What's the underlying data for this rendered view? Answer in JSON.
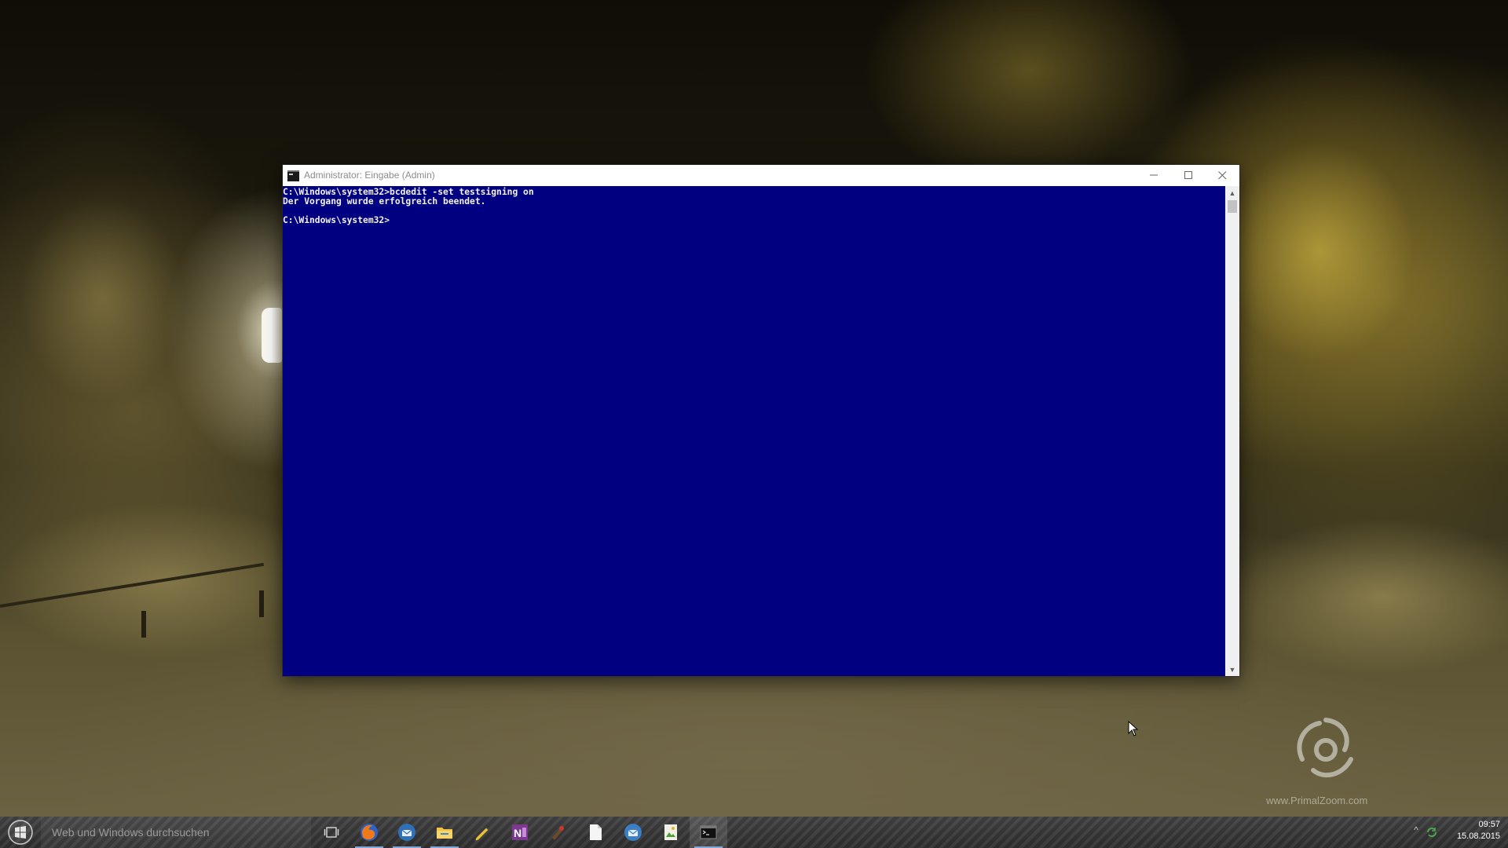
{
  "window": {
    "title": "Administrator: Eingabe (Admin)",
    "minimize_glyph": "—",
    "maximize_glyph": "☐",
    "close_glyph": "✕"
  },
  "console": {
    "background_color": "#010080",
    "text_color": "#f2f2f2",
    "lines": [
      "C:\\Windows\\system32>bcdedit -set testsigning on",
      "Der Vorgang wurde erfolgreich beendet.",
      "",
      "C:\\Windows\\system32>"
    ]
  },
  "scrollbar": {
    "up_glyph": "▲",
    "down_glyph": "▼"
  },
  "taskbar": {
    "search_placeholder": "Web und Windows durchsuchen",
    "apps": [
      {
        "icon": "firefox-icon",
        "running": true
      },
      {
        "icon": "thunderbird-icon",
        "running": true
      },
      {
        "icon": "file-explorer-icon",
        "running": true
      },
      {
        "icon": "pencil-tool-icon",
        "running": false
      },
      {
        "icon": "onenote-icon",
        "running": false
      },
      {
        "icon": "paint-tool-icon",
        "running": false
      },
      {
        "icon": "blank-document-icon",
        "running": false
      },
      {
        "icon": "mail-client-icon",
        "running": false
      },
      {
        "icon": "image-viewer-icon",
        "running": false
      },
      {
        "icon": "command-prompt-icon",
        "running": true,
        "active": true
      }
    ],
    "tray_chevron": "^",
    "clock_time": "09:57",
    "clock_date": "15.08.2015"
  },
  "desktop": {
    "watermark_text": "www.PrimalZoom.com"
  }
}
